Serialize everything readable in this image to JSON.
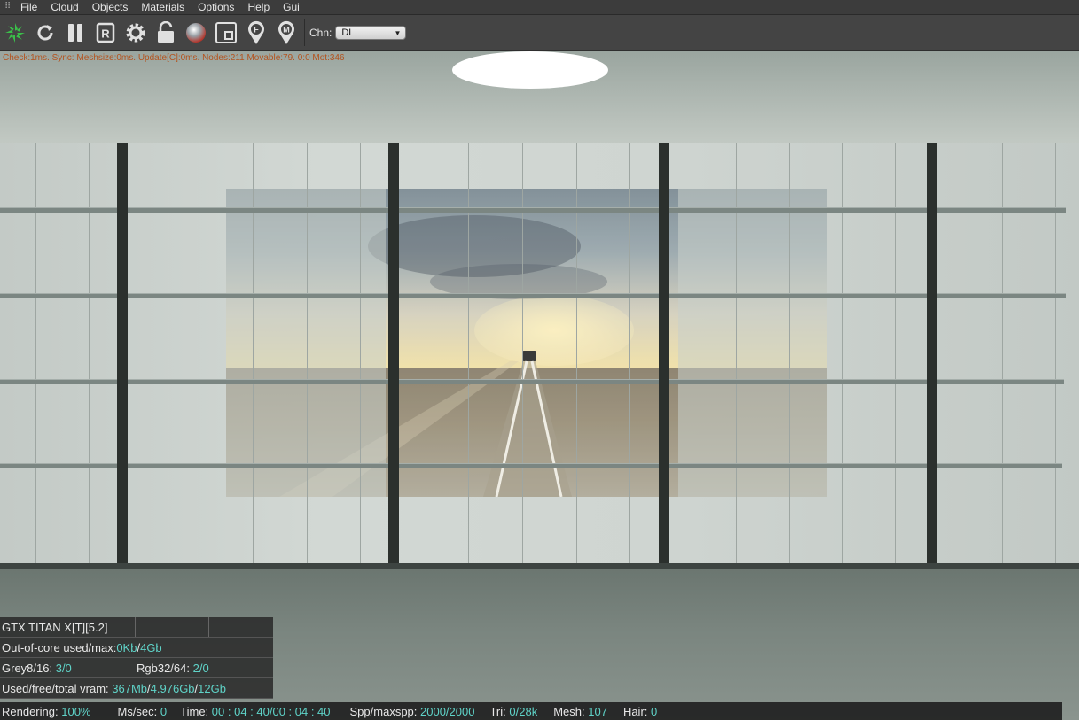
{
  "menu": {
    "items": [
      "File",
      "Cloud",
      "Objects",
      "Materials",
      "Options",
      "Help",
      "Gui"
    ]
  },
  "toolbar": {
    "icons": [
      "octane-logo-icon",
      "refresh-icon",
      "pause-icon",
      "render-region-icon",
      "settings-gear-icon",
      "lock-icon",
      "material-sphere-icon",
      "viewport-frame-icon",
      "focus-pin-icon",
      "material-pin-icon"
    ],
    "channel_label": "Chn:",
    "channel_value": "DL"
  },
  "viewport": {
    "debug_text": "Check:1ms. Sync: Meshsize:0ms. Update[C]:0ms. Nodes:211 Movable:79. 0:0 Mot:346"
  },
  "stats": {
    "gpu": "GTX TITAN X[T][5.2]",
    "out_of_core_label": "Out-of-core used/max:",
    "out_of_core_used": "0Kb",
    "out_of_core_sep": "/",
    "out_of_core_max": "4Gb",
    "grey_label": "Grey8/16:",
    "grey_value": "3/0",
    "rgb_label": "Rgb32/64:",
    "rgb_value": "2/0",
    "vram_label": "Used/free/total vram:",
    "vram_used": "367Mb",
    "vram_free": "4.976Gb",
    "vram_total": "12Gb",
    "sep": "/"
  },
  "status": {
    "rendering_label": "Rendering:",
    "rendering_value": "100%",
    "ms_label": "Ms/sec:",
    "ms_value": "0",
    "time_label": "Time:",
    "time_value": "00 : 04 : 40/00 : 04 : 40",
    "spp_label": "Spp/maxspp:",
    "spp_value": "2000/2000",
    "tri_label": "Tri:",
    "tri_value": "0/28k",
    "mesh_label": "Mesh:",
    "mesh_value": "107",
    "hair_label": "Hair:",
    "hair_value": "0"
  },
  "colors": {
    "stat_value": "#5fd3c8",
    "debug_text": "#b4531e",
    "logo_green": "#3bbf4a"
  }
}
